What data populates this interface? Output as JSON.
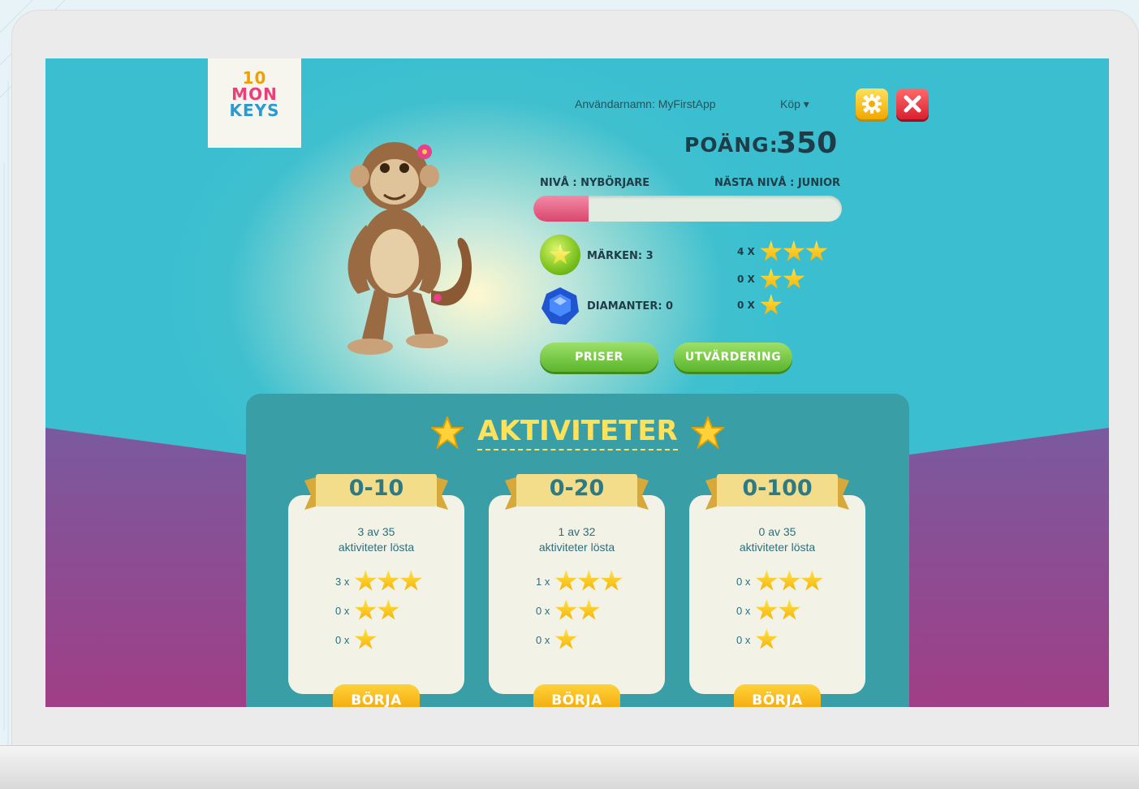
{
  "logo": {
    "line1": "10",
    "line2": "MON",
    "line3": "KEYS"
  },
  "header": {
    "username": "Användarnamn: MyFirstApp",
    "buy_menu": "Köp ▾",
    "points_label": "POÄNG:",
    "points_value": "350"
  },
  "level": {
    "current": "NIVÅ : NYBÖRJARE",
    "next": "NÄSTA NIVÅ : JUNIOR",
    "progress_fraction": 0.18
  },
  "stats": {
    "badges": "MÄRKEN: 3",
    "diamonds": "DIAMANTER: 0",
    "three_star_count": "4 X",
    "two_star_count": "0 X",
    "one_star_count": "0 X"
  },
  "buttons": {
    "prizes": "PRISER",
    "evaluation": "UTVÄRDERING"
  },
  "activities": {
    "title": "AKTIVITETER",
    "cards": [
      {
        "range": "0-10",
        "solved": "3 av 35",
        "solved_label": "aktiviteter lösta",
        "three": "3 x",
        "two": "0 x",
        "one": "0 x",
        "start": "BÖRJA"
      },
      {
        "range": "0-20",
        "solved": "1 av 32",
        "solved_label": "aktiviteter lösta",
        "three": "1 x",
        "two": "0 x",
        "one": "0 x",
        "start": "BÖRJA"
      },
      {
        "range": "0-100",
        "solved": "0 av 35",
        "solved_label": "aktiviteter lösta",
        "three": "0 x",
        "two": "0 x",
        "one": "0 x",
        "start": "BÖRJA"
      }
    ]
  },
  "colors": {
    "teal_bg": "#3bbfd0",
    "panel": "#3a9ea6",
    "accent_yellow": "#ffe15a",
    "progress_pink": "#d9466e",
    "green_button": "#5cb52c",
    "dark_text": "#1d3d48"
  },
  "icons": [
    "gear-icon",
    "close-icon",
    "star-badge-icon",
    "diamond-icon",
    "star-icon",
    "monkey-mascot"
  ]
}
